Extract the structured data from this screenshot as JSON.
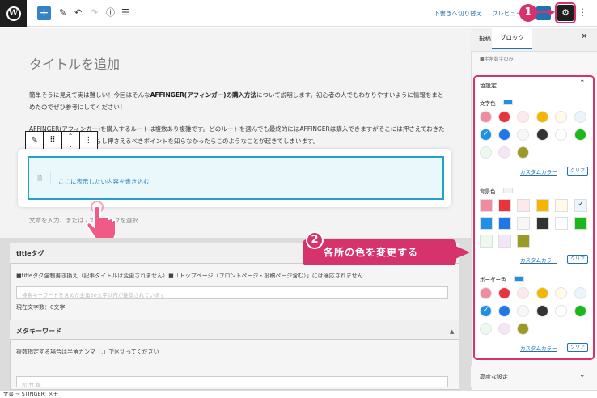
{
  "topbar": {
    "draft_label": "下書きへ切り替え",
    "preview_label": "プレビュー"
  },
  "editor": {
    "title_placeholder": "タイトルを追加",
    "para1_plain1": "簡単そうに見えて実は難しい！今回はそんな",
    "para1_bold": "AFFINGER(アフィンガー)の購入方法",
    "para1_plain2": "について説明します。初心者の人でもわかりやすいように情報をまとめたのでぜひ参考にしてください！",
    "para2": "AFFINGER(アフィンガー)を購入するルートは複数あり複雑です。どのルートを選んでも最終的にはAFFINGERは購入できますがそこには押さえておきたいポイントもあります。もし押さえるべきポイントを知らなかったらこのようなことが起きてしまいます。",
    "block_text": "ここに表示したい内容を書き込む",
    "append_placeholder": "文章を入力、または / でブロックを選択"
  },
  "meta": {
    "title_section": "titleタグ",
    "title_desc": "■titleタグ強制書き換え（記事タイトルは変更されません）■「トップページ（フロントページ・投稿ページ含む）」には適応されません",
    "title_input_placeholder": "検索キーワードを含めた全角30文字以内が推奨されています",
    "char_count": "現在文字数：0文字",
    "keyword_section": "メタキーワード",
    "keyword_desc": "複数指定する場合は半角カンマ「,」で区切ってください",
    "keyword_input_placeholder": "松,竹,梅"
  },
  "footer": {
    "breadcrumb": "文書 → STINGER: メモ"
  },
  "sidebar": {
    "tab_post": "投稿",
    "tab_block": "ブロック",
    "note": "■半角数字のみ",
    "panel_title": "色設定",
    "groups": [
      {
        "label": "文字色",
        "indicator": "#1e90e6",
        "style": "circle",
        "custom_label": "カスタムカラー",
        "clear_label": "クリア"
      },
      {
        "label": "背景色",
        "indicator": "#f2f2f2",
        "style": "square",
        "custom_label": "カスタムカラー",
        "clear_label": "クリア"
      },
      {
        "label": "ボーダー色",
        "indicator": "#1e90e6",
        "style": "circle",
        "custom_label": "カスタムカラー",
        "clear_label": "クリア"
      }
    ],
    "swatches": [
      "#f08ca0",
      "#e8343f",
      "#fde8ec",
      "#f5b600",
      "#fffbe6",
      "#eaf6fb",
      "#1e90e6",
      "#1e78e6",
      "#f7f7f7",
      "#333333",
      "#ffffff",
      "#1ab81a",
      "#edf9ee",
      "#f2e6f7",
      "#9a9a24"
    ],
    "advanced_label": "高度な設定"
  },
  "annotations": {
    "step1": "1",
    "step2": "2",
    "callout": "各所の色を変更する",
    "accent": "#d6336c"
  }
}
